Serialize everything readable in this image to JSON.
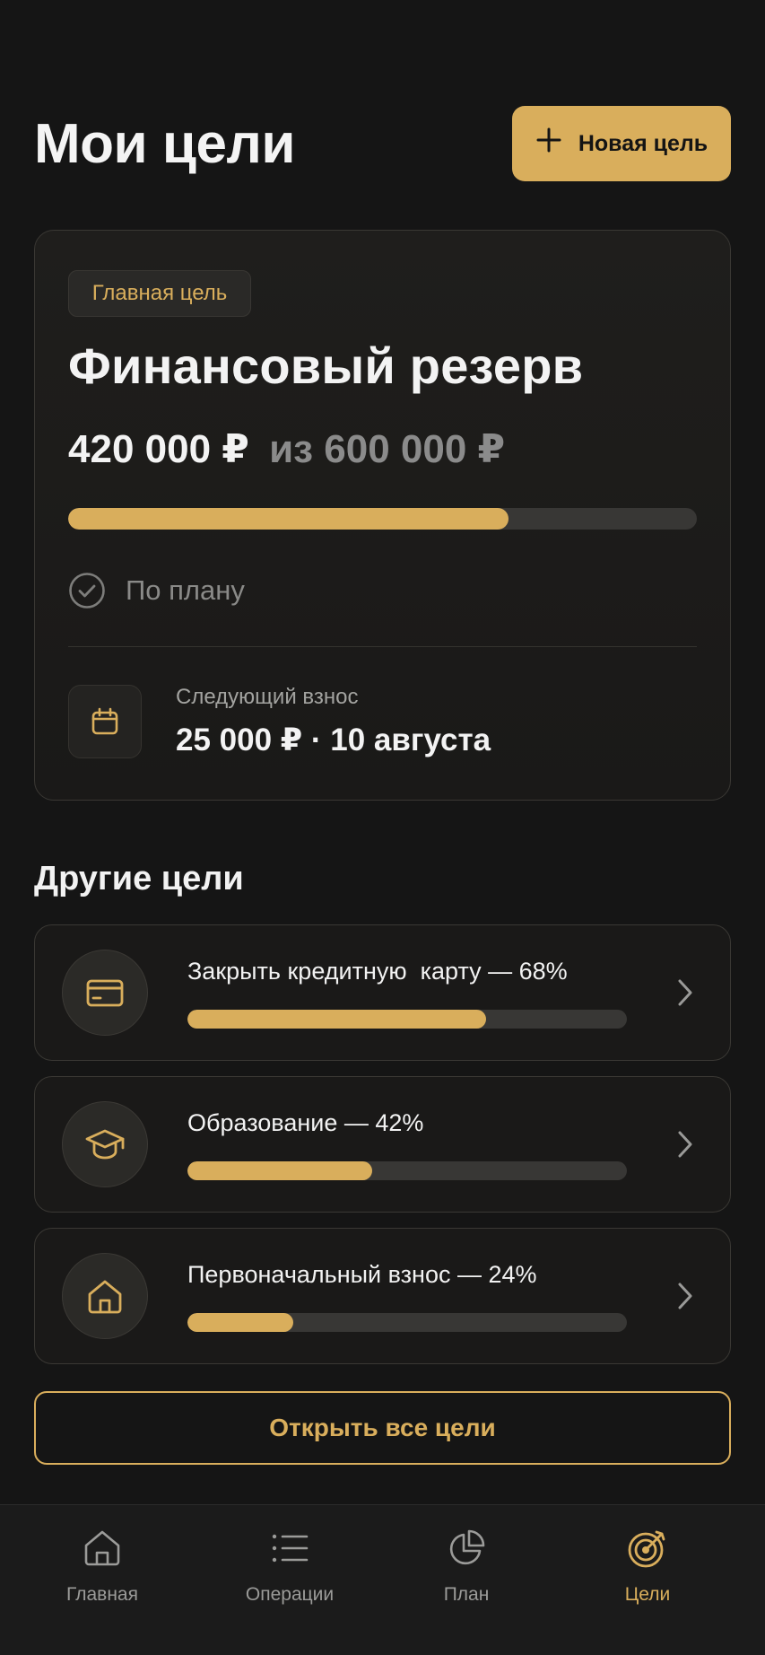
{
  "header": {
    "title": "Мои цели",
    "new_goal_label": "Новая цель",
    "new_goal_icon": "plus-icon"
  },
  "main_goal": {
    "badge": "Главная цель",
    "name": "Финансовый резерв",
    "current": "420 000 ₽",
    "of_text": "из",
    "total": "600 000 ₽",
    "progress_fraction": 0.7,
    "status_icon": "check-circle-icon",
    "status": "По плану",
    "next_icon": "calendar-icon",
    "next_label": "Следующий взнос",
    "next_value": "25 000 ₽ · 10 августа"
  },
  "others": {
    "title": "Другие цели",
    "items": [
      {
        "label": "Закрыть кредитную  карту — 68%",
        "progress_fraction": 0.68,
        "icon": "credit-card-icon"
      },
      {
        "label": "Образование — 42%",
        "progress_fraction": 0.42,
        "icon": "graduation-cap-icon"
      },
      {
        "label": "Первоначальный взнос — 24%",
        "progress_fraction": 0.24,
        "icon": "house-icon"
      }
    ]
  },
  "open_all_label": "Открыть все цели",
  "nav": {
    "items": [
      {
        "label": "Главная",
        "icon": "home-icon",
        "active": false
      },
      {
        "label": "Операции",
        "icon": "list-icon",
        "active": false
      },
      {
        "label": "План",
        "icon": "pie-chart-icon",
        "active": false
      },
      {
        "label": "Цели",
        "icon": "target-icon",
        "active": true
      }
    ]
  },
  "colors": {
    "accent": "#d9ae5c",
    "background": "#151515",
    "card": "#1a1918",
    "muted_text": "#8b8b8b"
  }
}
